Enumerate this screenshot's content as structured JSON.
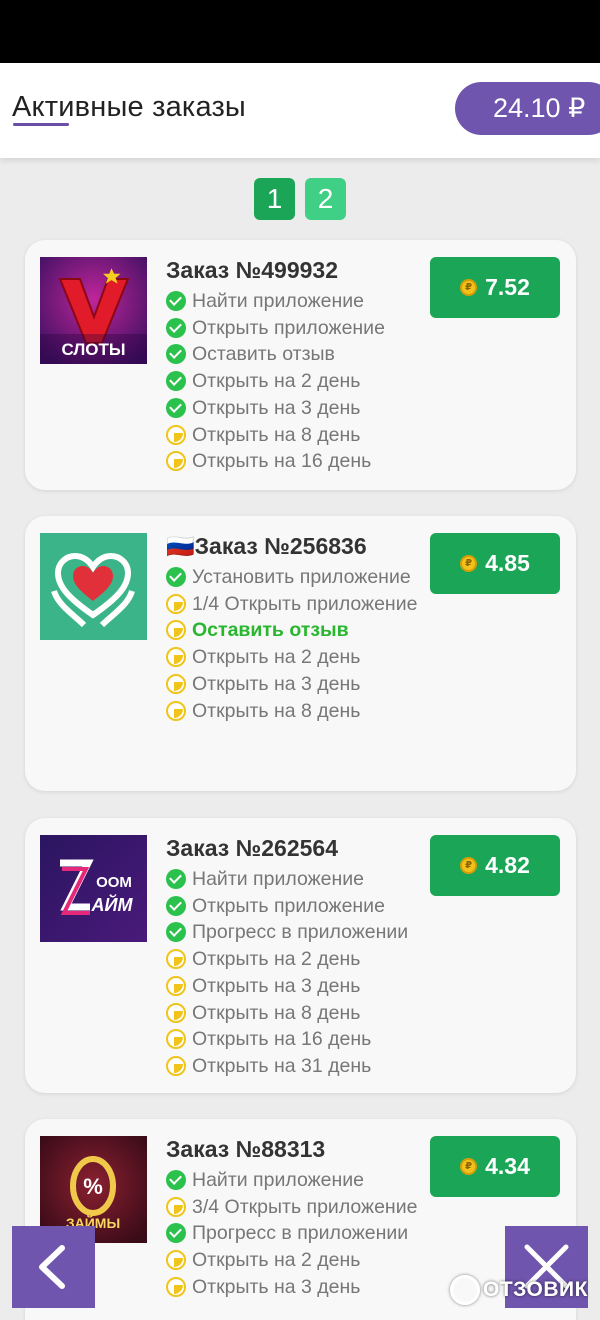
{
  "header": {
    "title": "Активные заказы",
    "balance": "24.10 ₽"
  },
  "pagination": {
    "pages": [
      "1",
      "2"
    ],
    "current": "1"
  },
  "orders": [
    {
      "title": "Заказ №499932",
      "reward": "7.52",
      "icon": "slots-app-icon",
      "icon_text": "СЛОТЫ",
      "tasks": [
        {
          "label": "Найти приложение",
          "status": "done"
        },
        {
          "label": "Открыть приложение",
          "status": "done"
        },
        {
          "label": "Оставить отзыв",
          "status": "done"
        },
        {
          "label": "Открыть на 2 день",
          "status": "done"
        },
        {
          "label": "Открыть на 3 день",
          "status": "done"
        },
        {
          "label": "Открыть на 8 день",
          "status": "pending"
        },
        {
          "label": "Открыть на 16 день",
          "status": "pending"
        }
      ]
    },
    {
      "title": "🇷🇺Заказ №256836",
      "reward": "4.85",
      "icon": "heart-hands-app-icon",
      "tasks": [
        {
          "label": "Установить приложение",
          "status": "done"
        },
        {
          "label": "1/4 Открыть приложение",
          "status": "pending"
        },
        {
          "label": "Оставить отзыв",
          "status": "pending",
          "highlight": true
        },
        {
          "label": "Открыть на 2 день",
          "status": "pending"
        },
        {
          "label": "Открыть на 3 день",
          "status": "pending"
        },
        {
          "label": "Открыть на 8 день",
          "status": "pending"
        }
      ]
    },
    {
      "title": "Заказ №262564",
      "reward": "4.82",
      "icon": "zoom-zaim-app-icon",
      "icon_text_top": "OOM",
      "icon_text_bottom": "АЙМ",
      "tasks": [
        {
          "label": "Найти приложение",
          "status": "done"
        },
        {
          "label": "Открыть приложение",
          "status": "done"
        },
        {
          "label": "Прогресс в приложении",
          "status": "done"
        },
        {
          "label": "Открыть на 2 день",
          "status": "pending"
        },
        {
          "label": "Открыть на 3 день",
          "status": "pending"
        },
        {
          "label": "Открыть на 8 день",
          "status": "pending"
        },
        {
          "label": "Открыть на 16 день",
          "status": "pending"
        },
        {
          "label": "Открыть на 31 день",
          "status": "pending"
        }
      ]
    },
    {
      "title": "Заказ №88313",
      "reward": "4.34",
      "icon": "zaymy-app-icon",
      "icon_text": "ЗАЙМЫ",
      "tasks": [
        {
          "label": "Найти приложение",
          "status": "done"
        },
        {
          "label": "3/4 Открыть приложение",
          "status": "pending"
        },
        {
          "label": "Прогресс в приложении",
          "status": "done"
        },
        {
          "label": "Открыть на 2 день",
          "status": "pending"
        },
        {
          "label": "Открыть на 3 день",
          "status": "pending"
        }
      ]
    }
  ],
  "colors": {
    "accent_purple": "#6f55ad",
    "reward_green": "#1aa656",
    "done_green": "#2bc14d",
    "pending_yellow": "#f0c419"
  },
  "nav": {
    "back_icon": "chevron-left-icon",
    "close_icon": "close-icon"
  },
  "watermark": {
    "text": "ОТЗОВИК"
  }
}
